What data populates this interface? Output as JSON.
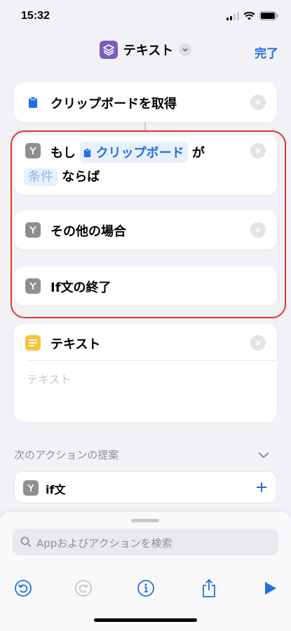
{
  "status": {
    "time": "15:32"
  },
  "nav": {
    "title": "テキスト",
    "done_label": "完了"
  },
  "actions": {
    "get_clipboard": "クリップボードを取得",
    "if_prefix": "もし",
    "if_pill": "クリップボード",
    "if_ga": "が",
    "if_condition": "条件",
    "if_suffix": "ならば",
    "otherwise": "その他の場合",
    "end_if": "If文の終了",
    "text_title": "テキスト",
    "text_placeholder": "テキスト"
  },
  "suggestions": {
    "header": "次のアクションの提案",
    "items": [
      {
        "label": "if文"
      }
    ]
  },
  "search": {
    "placeholder": "Appおよびアクションを検索"
  },
  "colors": {
    "accent": "#1f6fe0",
    "highlight_border": "#e2342c",
    "app_icon": "#7d5bbe",
    "scripting_icon": "#8e8e93",
    "clipboard_icon": "#1f6fe0",
    "text_icon": "#f6c33a"
  },
  "icons": {
    "app": "shortcuts-icon",
    "clipboard": "clipboard-icon",
    "scripting": "y-branch-icon",
    "text": "text-lines-icon",
    "toolbar": [
      "undo-icon",
      "redo-icon",
      "info-icon",
      "share-icon",
      "play-icon"
    ]
  }
}
